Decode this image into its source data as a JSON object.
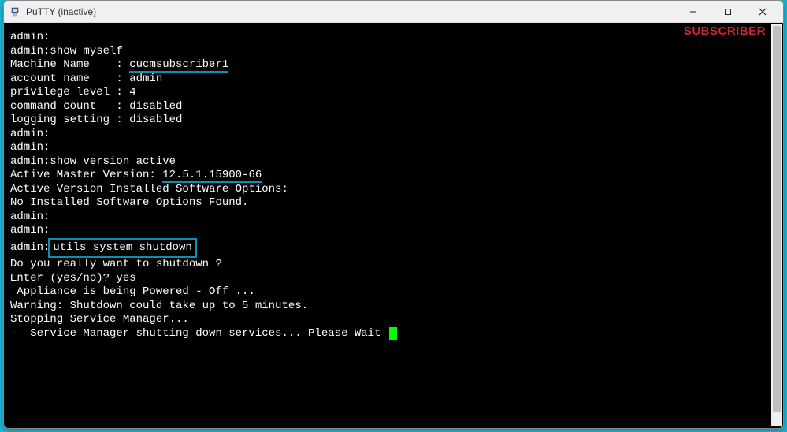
{
  "window": {
    "title": "PuTTY (inactive)"
  },
  "overlay": {
    "label": "SUBSCRIBER"
  },
  "terminal": {
    "lines": {
      "l0": "admin:",
      "l1_pre": "admin:",
      "l1_cmd": "show myself",
      "l2_label": "Machine Name    : ",
      "l2_value": "cucmsubscriber1",
      "l3": "account name    : admin",
      "l4": "privilege level : 4",
      "l5": "command count   : disabled",
      "l6": "logging setting : disabled",
      "l7": "admin:",
      "l8": "admin:",
      "l9_pre": "admin:",
      "l9_cmd": "show version active",
      "l10_label": "Active Master Version: ",
      "l10_value": "12.5.1.15900-66",
      "l11": "Active Version Installed Software Options:",
      "l12": "No Installed Software Options Found.",
      "l13": "admin:",
      "l14": "admin:",
      "l15_pre": "admin:",
      "l15_cmd": "utils system shutdown",
      "l16": "",
      "l17": "Do you really want to shutdown ?",
      "l18": "",
      "l19": "Enter (yes/no)? yes",
      "l20": "",
      "l21": "",
      "l22": " Appliance is being Powered - Off ...",
      "l23": "Warning: Shutdown could take up to 5 minutes.",
      "l24": "Stopping Service Manager...",
      "l25": "-  Service Manager shutting down services... Please Wait "
    }
  }
}
